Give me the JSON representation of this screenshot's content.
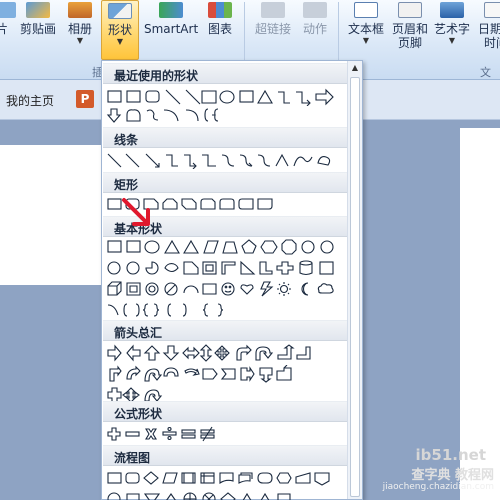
{
  "ribbon": {
    "buttons": [
      {
        "label": "片",
        "icon": "picture-icon"
      },
      {
        "label": "剪贴画",
        "icon": "clipart-icon"
      },
      {
        "label": "相册",
        "icon": "album-icon"
      },
      {
        "label": "形状",
        "icon": "shapes-icon"
      },
      {
        "label": "SmartArt",
        "icon": "smartart-icon"
      },
      {
        "label": "图表",
        "icon": "chart-icon"
      },
      {
        "label": "超链接",
        "icon": "hyperlink-icon"
      },
      {
        "label": "动作",
        "icon": "action-icon"
      },
      {
        "label": "文本框",
        "icon": "textbox-icon"
      },
      {
        "label": "页眉和\n页脚",
        "icon": "header-footer-icon"
      },
      {
        "label": "艺术字",
        "icon": "wordart-icon"
      },
      {
        "label": "日期和\n时间",
        "icon": "datetime-icon"
      }
    ],
    "group_label_left": "插",
    "group_label_right": "文本"
  },
  "tabstrip": {
    "home_tab": "我的主页",
    "app_icon": "P"
  },
  "shapes_menu": {
    "categories": [
      {
        "title": "最近使用的形状"
      },
      {
        "title": "线条"
      },
      {
        "title": "矩形"
      },
      {
        "title": "基本形状"
      },
      {
        "title": "箭头总汇"
      },
      {
        "title": "公式形状"
      },
      {
        "title": "流程图"
      }
    ]
  },
  "watermark": {
    "line1": "ib51.net",
    "line2": "查字典 教程网",
    "line3": "jiaocheng.chazidian.com"
  },
  "colors": {
    "accent": "#ffd66b",
    "ribbon": "#dbe8f7",
    "category_bg": "#e1e6ee",
    "arrow": "#e0182d",
    "shape_stroke": "#1b2a3f"
  }
}
